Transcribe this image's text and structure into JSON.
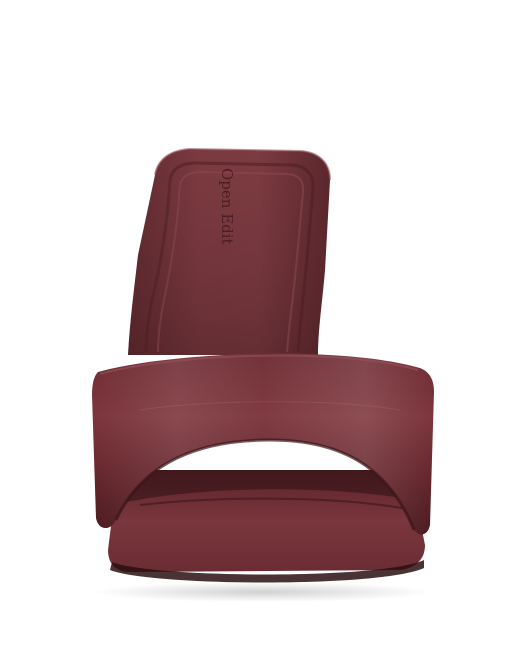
{
  "image": {
    "subject": "sandal",
    "background_color": "#ffffff",
    "leather_color": "#6a2a30",
    "insole_brand_text": "Open Edit"
  }
}
